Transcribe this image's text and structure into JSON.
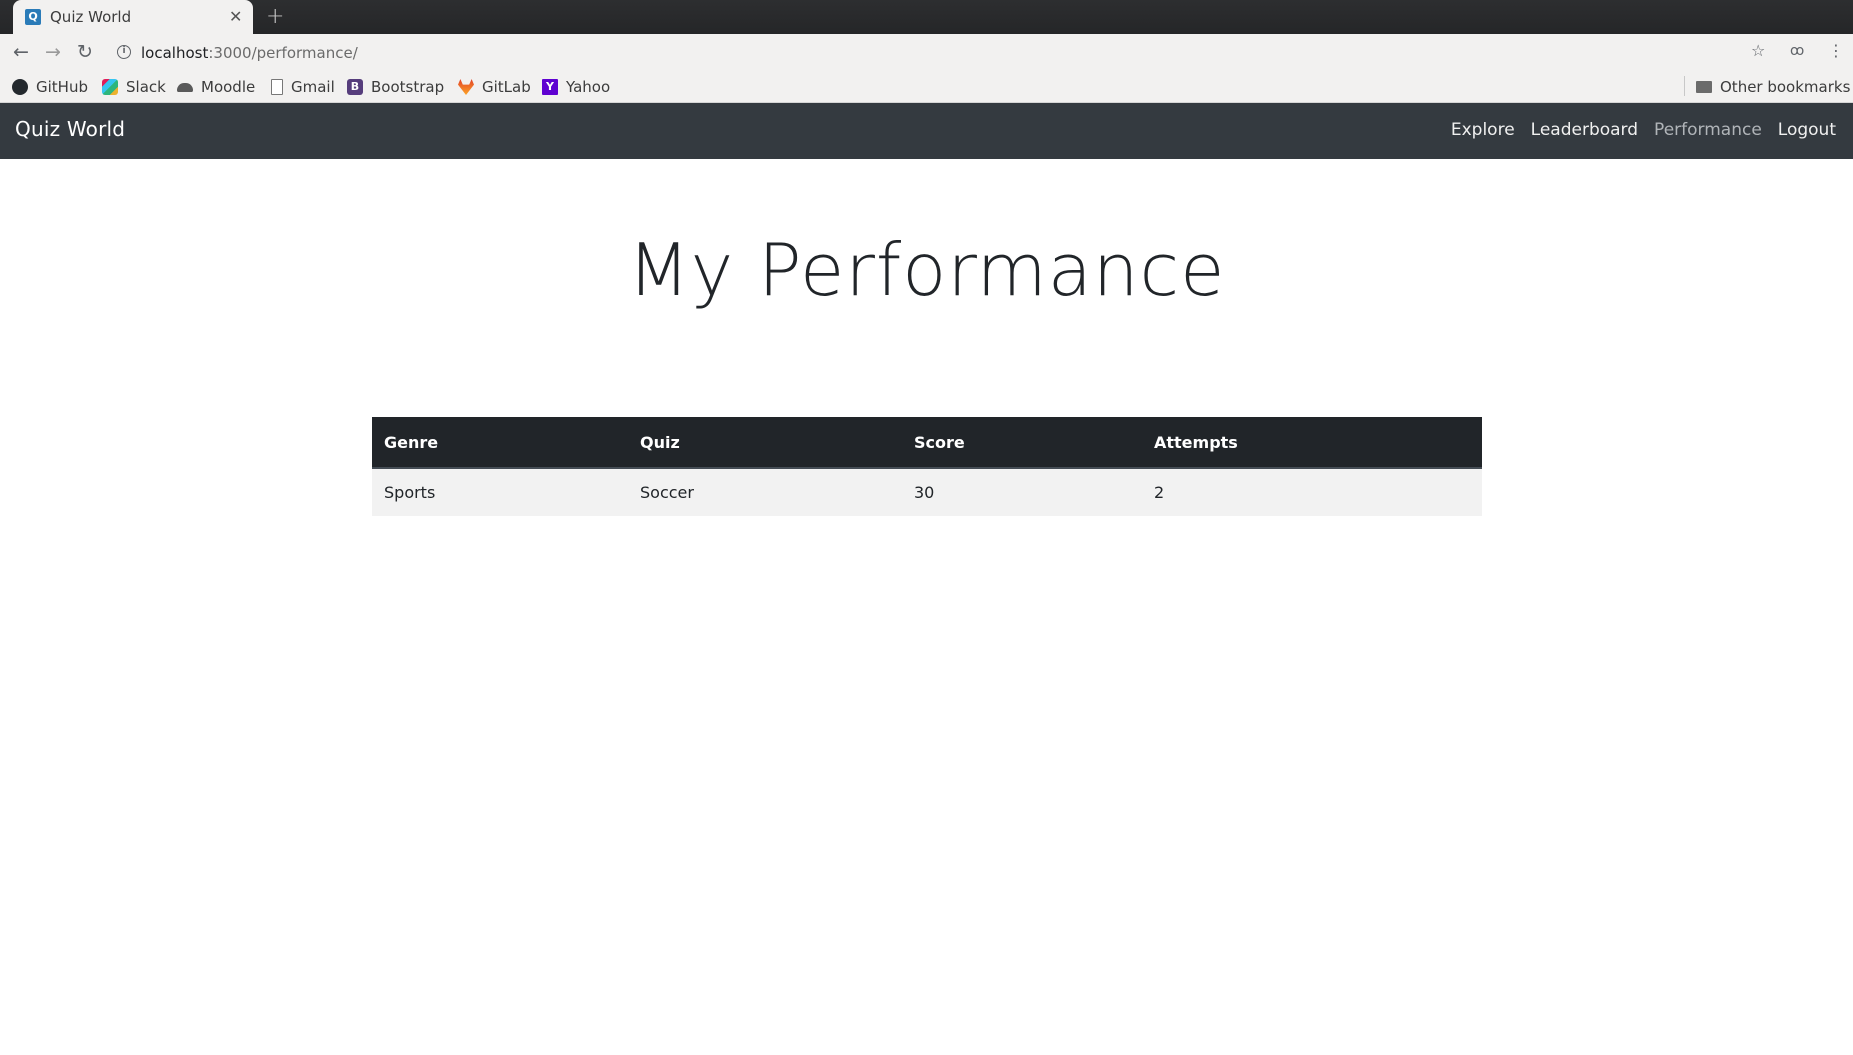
{
  "browser": {
    "tab_title": "Quiz World",
    "tab_favicon_letter": "Q",
    "url_host": "localhost",
    "url_path": ":3000/performance/",
    "bookmarks": [
      "GitHub",
      "Slack",
      "Moodle",
      "Gmail",
      "Bootstrap",
      "GitLab",
      "Yahoo"
    ],
    "other_bookmarks": "Other bookmarks"
  },
  "navbar": {
    "brand": "Quiz World",
    "links": [
      "Explore",
      "Leaderboard",
      "Performance",
      "Logout"
    ],
    "active": "Performance"
  },
  "page": {
    "title": "My Performance"
  },
  "table": {
    "headers": [
      "Genre",
      "Quiz",
      "Score",
      "Attempts"
    ],
    "rows": [
      [
        "Sports",
        "Soccer",
        "30",
        "2"
      ]
    ]
  },
  "colors": {
    "navbar_bg": "#343a40",
    "table_header_bg": "#212529",
    "table_row_bg": "#f2f2f2"
  }
}
